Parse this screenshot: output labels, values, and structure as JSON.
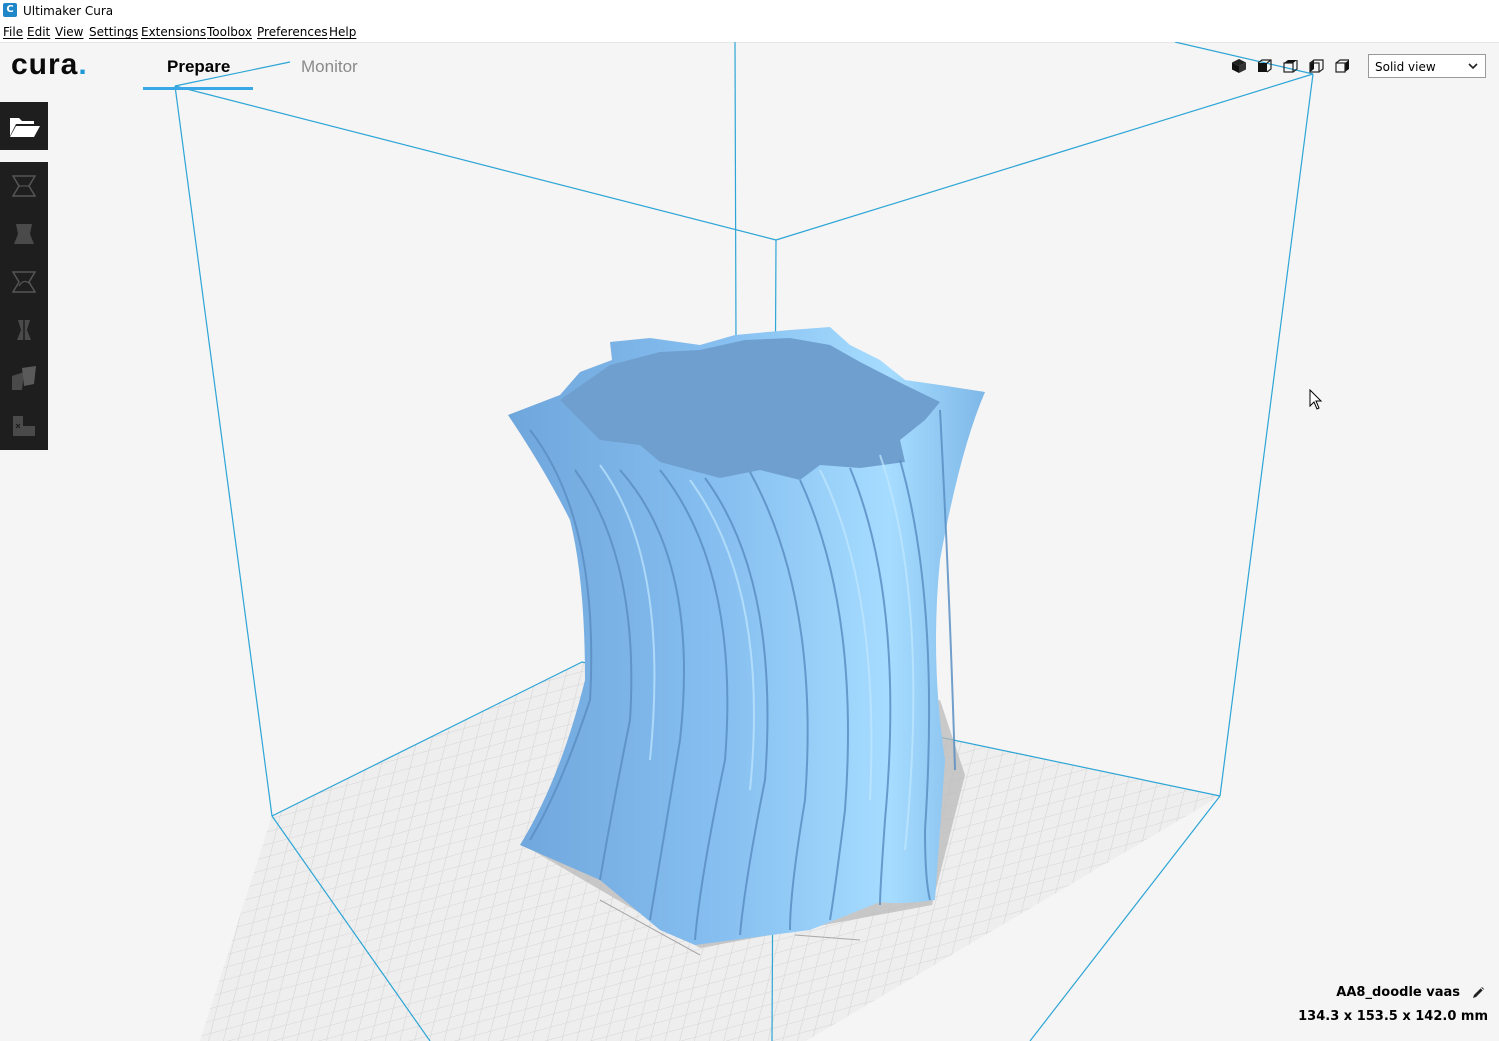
{
  "window": {
    "title": "Ultimaker Cura",
    "app_icon_glyph": "C"
  },
  "menu": {
    "items": [
      {
        "label": "File"
      },
      {
        "label": "Edit"
      },
      {
        "label": "View"
      },
      {
        "label": "Settings"
      },
      {
        "label": "Extensions"
      },
      {
        "label": "Toolbox"
      },
      {
        "label": "Preferences"
      },
      {
        "label": "Help"
      }
    ]
  },
  "header": {
    "logo_text": "cura",
    "logo_dot": ".",
    "tabs": [
      {
        "label": "Prepare",
        "active": true
      },
      {
        "label": "Monitor",
        "active": false
      }
    ]
  },
  "view": {
    "camera_buttons": [
      "3d-view-icon",
      "front-view-icon",
      "top-view-icon",
      "left-view-icon",
      "right-view-icon"
    ],
    "view_mode": "Solid view"
  },
  "tools": {
    "open_file": "open-folder-icon",
    "items": [
      "move-icon",
      "scale-icon",
      "rotate-icon",
      "mirror-icon",
      "per-model-settings-icon",
      "support-blocker-icon"
    ]
  },
  "object": {
    "name": "AA8_doodle vaas",
    "dimensions": "134.3 x 153.5 x 142.0 mm"
  },
  "colors": {
    "accent": "#3aa7e6",
    "toolbar_bg": "#1e1e1e",
    "model": "#8ec8f5",
    "build_volume_line": "#2da5d6",
    "background": "#f5f5f5"
  }
}
